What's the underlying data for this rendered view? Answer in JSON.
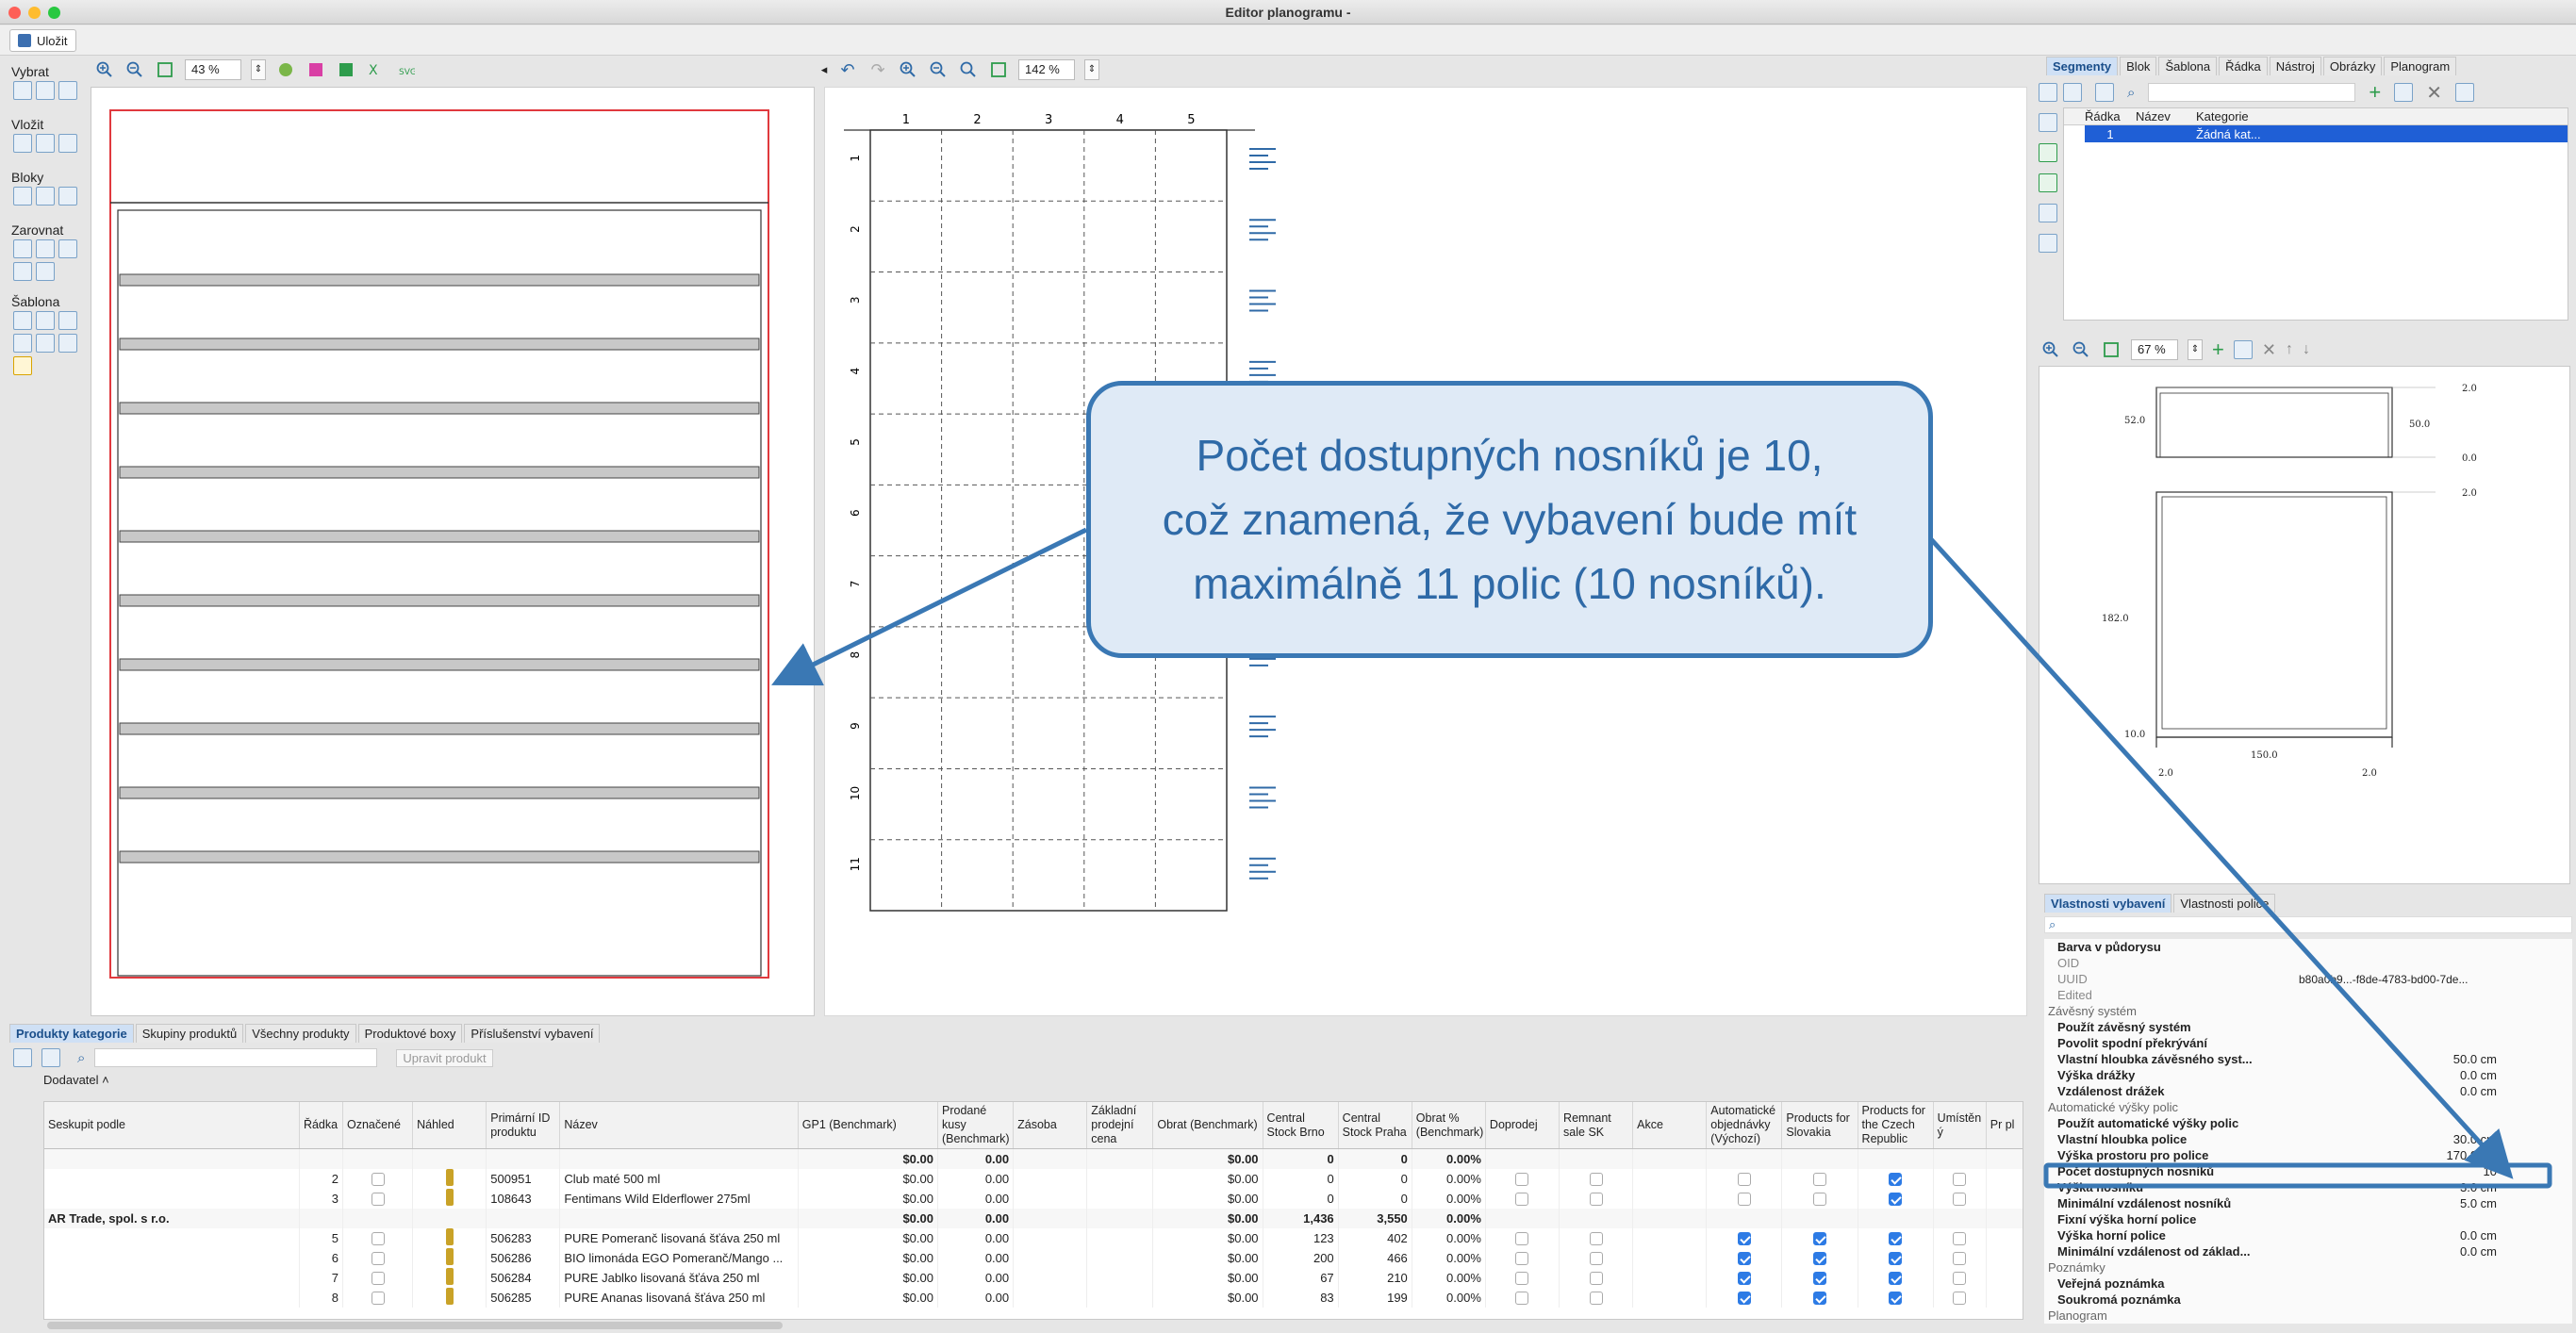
{
  "window": {
    "title": "Editor planogramu -"
  },
  "toolbar": {
    "save_label": "Uložit"
  },
  "palette": {
    "groups": [
      {
        "label": "Vybrat"
      },
      {
        "label": "Vložit"
      },
      {
        "label": "Bloky"
      },
      {
        "label": "Zarovnat"
      },
      {
        "label": "Šablona"
      }
    ]
  },
  "left_view": {
    "zoom": "43 %"
  },
  "mid_view": {
    "zoom": "142 %",
    "columns": [
      "1",
      "2",
      "3",
      "4",
      "5"
    ],
    "rows": [
      "1",
      "2",
      "3",
      "4",
      "5",
      "6",
      "7",
      "8",
      "9",
      "10",
      "11"
    ]
  },
  "right_top": {
    "tabs": [
      "Segmenty",
      "Blok",
      "Šablona",
      "Řádka",
      "Nástroj",
      "Obrázky",
      "Planogram"
    ],
    "active_tab": "Segmenty",
    "headers": [
      "Řádka",
      "Název",
      "Kategorie"
    ],
    "row": {
      "radka": "1",
      "nazev": "",
      "kategorie": "Žádná kat..."
    }
  },
  "preview": {
    "zoom": "67 %",
    "dims": {
      "d1": "2.0",
      "d2": "52.0",
      "d3": "50.0",
      "d4": "0.0",
      "d5": "2.0",
      "d6": "182.0",
      "d7": "10.0",
      "d8": "150.0",
      "d9": "2.0",
      "d10": "2.0"
    }
  },
  "props": {
    "tabs": [
      "Vlastnosti vybavení",
      "Vlastnosti police"
    ],
    "rows": [
      {
        "name": "Barva v půdorysu",
        "value": "",
        "kind": "bold"
      },
      {
        "name": "OID",
        "value": "",
        "kind": "gray"
      },
      {
        "name": "UUID",
        "value": "b80a0b9...-f8de-4783-bd00-7de...",
        "kind": "gray"
      },
      {
        "name": "Edited",
        "value": "",
        "kind": "gray"
      },
      {
        "name": "Závěsný systém",
        "value": "",
        "kind": "grp"
      },
      {
        "name": "Použít závěsný systém",
        "value": "",
        "kind": "bold"
      },
      {
        "name": "Povolit spodní překrývání",
        "value": "",
        "kind": "bold"
      },
      {
        "name": "Vlastní hloubka závěsného syst...",
        "value": "50.0 cm",
        "kind": "bold"
      },
      {
        "name": "Výška drážky",
        "value": "0.0 cm",
        "kind": "bold"
      },
      {
        "name": "Vzdálenost drážek",
        "value": "0.0 cm",
        "kind": "bold"
      },
      {
        "name": "Automatické výšky polic",
        "value": "",
        "kind": "grp"
      },
      {
        "name": "Použít automatické výšky polic",
        "value": "",
        "kind": "bold"
      },
      {
        "name": "Vlastní hloubka police",
        "value": "30.0 cm",
        "kind": "bold"
      },
      {
        "name": "Výška prostoru pro police",
        "value": "170.0 cm",
        "kind": "bold"
      },
      {
        "name": "Počet dostupných nosníků",
        "value": "10",
        "kind": "bold"
      },
      {
        "name": "Výška nosníku",
        "value": "3.0 cm",
        "kind": "bold"
      },
      {
        "name": "Minimální vzdálenost nosníků",
        "value": "5.0 cm",
        "kind": "bold"
      },
      {
        "name": "Fixní výška horní police",
        "value": "",
        "kind": "bold"
      },
      {
        "name": "Výška horní police",
        "value": "0.0 cm",
        "kind": "bold"
      },
      {
        "name": "Minimální vzdálenost od základ...",
        "value": "0.0 cm",
        "kind": "bold"
      },
      {
        "name": "Poznámky",
        "value": "",
        "kind": "grp"
      },
      {
        "name": "Veřejná poznámka",
        "value": "",
        "kind": "bold"
      },
      {
        "name": "Soukromá poznámka",
        "value": "",
        "kind": "bold"
      },
      {
        "name": "Planogram",
        "value": "",
        "kind": "grp"
      }
    ]
  },
  "bottom": {
    "tabs": [
      "Produkty kategorie",
      "Skupiny produktů",
      "Všechny produkty",
      "Produktové boxy",
      "Příslušenství vybavení"
    ],
    "edit_btn": "Upravit produkt",
    "group_by": "Dodavatel",
    "columns": [
      "Seskupit podle",
      "Řádka",
      "Označené",
      "Náhled",
      "Primární ID produktu",
      "Název",
      "GP1 (Benchmark)",
      "Prodané kusy (Benchmark)",
      "Zásoba",
      "Základní prodejní cena",
      "Obrat (Benchmark)",
      "Central Stock Brno",
      "Central Stock Praha",
      "Obrat % (Benchmark)",
      "Doprodej",
      "Remnant sale SK",
      "Akce",
      "Automatické objednávky (Výchozí)",
      "Products for Slovakia",
      "Products for the Czech Republic",
      "Umístěn ý",
      "Pr pl"
    ],
    "rows": [
      {
        "group": "",
        "radka": "",
        "id": "",
        "nazev": "",
        "gp1": "$0.00",
        "kusy": "0.00",
        "obrat": "$0.00",
        "brno": "0",
        "praha": "0",
        "pct": "0.00%",
        "type": "sum",
        "auto": false,
        "sk": false,
        "cz": false
      },
      {
        "group": "",
        "radka": "2",
        "id": "500951",
        "nazev": "Club maté 500 ml",
        "gp1": "$0.00",
        "kusy": "0.00",
        "obrat": "$0.00",
        "brno": "0",
        "praha": "0",
        "pct": "0.00%",
        "type": "item",
        "auto": false,
        "sk": false,
        "cz": true
      },
      {
        "group": "",
        "radka": "3",
        "id": "108643",
        "nazev": "Fentimans Wild Elderflower 275ml",
        "gp1": "$0.00",
        "kusy": "0.00",
        "obrat": "$0.00",
        "brno": "0",
        "praha": "0",
        "pct": "0.00%",
        "type": "item",
        "auto": false,
        "sk": false,
        "cz": true
      },
      {
        "group": "AR Trade, spol. s r.o.",
        "radka": "",
        "id": "",
        "nazev": "",
        "gp1": "$0.00",
        "kusy": "0.00",
        "obrat": "$0.00",
        "brno": "1,436",
        "praha": "3,550",
        "pct": "0.00%",
        "type": "sum",
        "auto": false,
        "sk": false,
        "cz": false
      },
      {
        "group": "",
        "radka": "5",
        "id": "506283",
        "nazev": "PURE Pomeranč lisovaná šťáva 250 ml",
        "gp1": "$0.00",
        "kusy": "0.00",
        "obrat": "$0.00",
        "brno": "123",
        "praha": "402",
        "pct": "0.00%",
        "type": "item",
        "auto": true,
        "sk": true,
        "cz": true
      },
      {
        "group": "",
        "radka": "6",
        "id": "506286",
        "nazev": "BIO limonáda EGO Pomeranč/Mango ...",
        "gp1": "$0.00",
        "kusy": "0.00",
        "obrat": "$0.00",
        "brno": "200",
        "praha": "466",
        "pct": "0.00%",
        "type": "item",
        "auto": true,
        "sk": true,
        "cz": true
      },
      {
        "group": "",
        "radka": "7",
        "id": "506284",
        "nazev": "PURE Jablko lisovaná šťáva 250 ml",
        "gp1": "$0.00",
        "kusy": "0.00",
        "obrat": "$0.00",
        "brno": "67",
        "praha": "210",
        "pct": "0.00%",
        "type": "item",
        "auto": true,
        "sk": true,
        "cz": true
      },
      {
        "group": "",
        "radka": "8",
        "id": "506285",
        "nazev": "PURE Ananas lisovaná šťáva 250 ml",
        "gp1": "$0.00",
        "kusy": "0.00",
        "obrat": "$0.00",
        "brno": "83",
        "praha": "199",
        "pct": "0.00%",
        "type": "item",
        "auto": true,
        "sk": true,
        "cz": true
      }
    ]
  },
  "callout": {
    "line1": "Počet dostupných nosníků je 10,",
    "line2": "což znamená, že vybavení bude mít",
    "line3": "maximálně 11 polic (10 nosníků)."
  },
  "colors": {
    "accent": "#3a78b4",
    "callout_bg": "#dfeaf6",
    "select": "#1f5fd6",
    "frame_red": "#e0393e"
  }
}
